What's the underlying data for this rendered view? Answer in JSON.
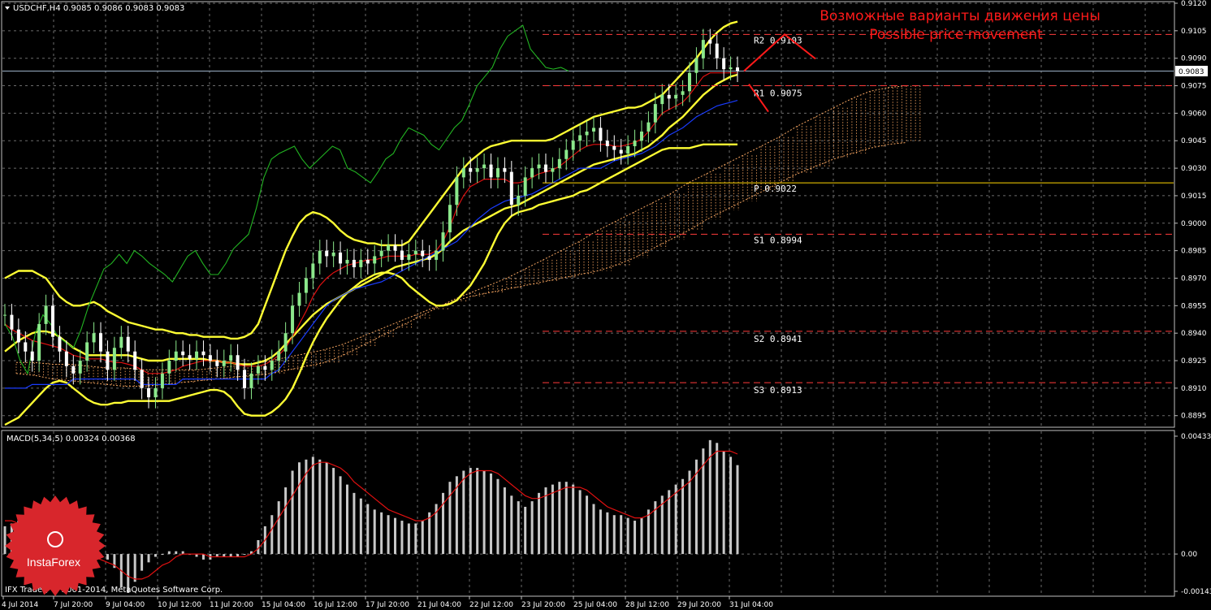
{
  "header": {
    "symbol_line": "USDCHF,H4  0.9085 0.9086 0.9083 0.9083",
    "annotation_ru": "Возможные варианты движения цены",
    "annotation_en": "Possible price movement"
  },
  "macd": {
    "label": "MACD(5,34,5) 0.00324 0.00368",
    "y_ticks": [
      "0.00433",
      "0.00",
      "-0.00143"
    ]
  },
  "footer": {
    "copyright": "IFX Trader, © 2001-2014, MetaQuotes Software Corp."
  },
  "logo": {
    "text": "InstaForex"
  },
  "chart_data": {
    "type": "candlestick",
    "symbol": "USDCHF",
    "timeframe": "H4",
    "ohlc_last": {
      "open": 0.9085,
      "high": 0.9086,
      "low": 0.9083,
      "close": 0.9083
    },
    "price_axis": {
      "ylim": [
        0.889,
        0.912
      ],
      "ticks": [
        "0.9120",
        "0.9105",
        "0.9090",
        "0.9075",
        "0.9060",
        "0.9045",
        "0.9030",
        "0.9015",
        "0.9000",
        "0.8985",
        "0.8970",
        "0.8955",
        "0.8940",
        "0.8925",
        "0.8910",
        "0.8895"
      ]
    },
    "current_price": "0.9083",
    "x_ticks": [
      "4 Jul 2014",
      "7 Jul 20:00",
      "9 Jul 04:00",
      "10 Jul 12:00",
      "11 Jul 20:00",
      "15 Jul 04:00",
      "16 Jul 12:00",
      "17 Jul 20:00",
      "21 Jul 04:00",
      "22 Jul 12:00",
      "23 Jul 20:00",
      "25 Jul 04:00",
      "28 Jul 12:00",
      "29 Jul 20:00",
      "31 Jul 04:00"
    ],
    "pivot_levels": [
      {
        "name": "R2",
        "value": 0.9103,
        "label": "R2  0.9103",
        "color": "#ff3b3b"
      },
      {
        "name": "R1",
        "value": 0.9075,
        "label": "R1  0.9075",
        "color": "#ff3b3b"
      },
      {
        "name": "P",
        "value": 0.9022,
        "label": "P  0.9022",
        "color": "#ffd700"
      },
      {
        "name": "S1",
        "value": 0.8994,
        "label": "S1  0.8994",
        "color": "#ff3b3b"
      },
      {
        "name": "S2",
        "value": 0.8941,
        "label": "S2  0.8941",
        "color": "#ff3b3b"
      },
      {
        "name": "S3",
        "value": 0.8913,
        "label": "S3  0.8913",
        "color": "#ff3b3b"
      }
    ],
    "series": {
      "close": [
        0.895,
        0.8942,
        0.8935,
        0.893,
        0.8925,
        0.8945,
        0.8955,
        0.8938,
        0.893,
        0.8922,
        0.8918,
        0.8925,
        0.8935,
        0.894,
        0.893,
        0.892,
        0.8932,
        0.8938,
        0.893,
        0.892,
        0.891,
        0.8905,
        0.891,
        0.8918,
        0.8925,
        0.893,
        0.8928,
        0.8926,
        0.893,
        0.8928,
        0.8925,
        0.8922,
        0.8925,
        0.8928,
        0.892,
        0.891,
        0.8918,
        0.8922,
        0.892,
        0.8925,
        0.893,
        0.894,
        0.8955,
        0.8962,
        0.897,
        0.8978,
        0.8985,
        0.8982,
        0.8984,
        0.8978,
        0.898,
        0.8976,
        0.898,
        0.8978,
        0.8982,
        0.8985,
        0.8988,
        0.8985,
        0.898,
        0.8983,
        0.8985,
        0.8982,
        0.898,
        0.8985,
        0.8995,
        0.901,
        0.9025,
        0.903,
        0.9028,
        0.903,
        0.9032,
        0.9025,
        0.903,
        0.9028,
        0.901,
        0.9015,
        0.9025,
        0.903,
        0.9032,
        0.9028,
        0.903,
        0.9035,
        0.904,
        0.9045,
        0.9048,
        0.905,
        0.9052,
        0.9045,
        0.9042,
        0.904,
        0.9038,
        0.9042,
        0.9045,
        0.905,
        0.9055,
        0.9065,
        0.907,
        0.9068,
        0.907,
        0.9072,
        0.9082,
        0.909,
        0.91,
        0.9098,
        0.909,
        0.9084,
        0.9085,
        0.9083
      ],
      "tenkan": [
        0.8945,
        0.8942,
        0.894,
        0.8938,
        0.8936,
        0.8935,
        0.8934,
        0.8933,
        0.8932,
        0.893,
        0.8928,
        0.8927,
        0.8926,
        0.8926,
        0.8926,
        0.8925,
        0.8924,
        0.8924,
        0.8923,
        0.8922,
        0.892,
        0.8918,
        0.8918,
        0.8918,
        0.8919,
        0.892,
        0.8922,
        0.8923,
        0.8924,
        0.8925,
        0.8925,
        0.8925,
        0.8924,
        0.8924,
        0.8923,
        0.8922,
        0.8922,
        0.8922,
        0.8923,
        0.8925,
        0.8928,
        0.8932,
        0.8938,
        0.8945,
        0.8952,
        0.896,
        0.8966,
        0.897,
        0.8973,
        0.8975,
        0.8977,
        0.8978,
        0.8979,
        0.898,
        0.898,
        0.8981,
        0.8982,
        0.8982,
        0.8982,
        0.8982,
        0.8983,
        0.8983,
        0.8983,
        0.8985,
        0.899,
        0.8998,
        0.9008,
        0.9015,
        0.902,
        0.9022,
        0.9024,
        0.9024,
        0.9024,
        0.9024,
        0.9022,
        0.9022,
        0.9023,
        0.9025,
        0.9027,
        0.9028,
        0.9029,
        0.9031,
        0.9034,
        0.9037,
        0.904,
        0.9042,
        0.9043,
        0.9043,
        0.9043,
        0.9042,
        0.9042,
        0.9043,
        0.9044,
        0.9046,
        0.905,
        0.9055,
        0.906,
        0.9062,
        0.9064,
        0.9066,
        0.907,
        0.9075,
        0.908,
        0.9082,
        0.9082,
        0.9082,
        0.9082,
        0.9082
      ],
      "kijun": [
        0.891,
        0.891,
        0.891,
        0.891,
        0.8912,
        0.8912,
        0.8912,
        0.8912,
        0.8912,
        0.8912,
        0.8915,
        0.8915,
        0.8915,
        0.8915,
        0.8915,
        0.8915,
        0.8915,
        0.8915,
        0.8915,
        0.8915,
        0.8912,
        0.8912,
        0.8912,
        0.8912,
        0.8912,
        0.8912,
        0.8915,
        0.8915,
        0.8915,
        0.8915,
        0.8915,
        0.8915,
        0.8915,
        0.8915,
        0.8915,
        0.8915,
        0.8915,
        0.8915,
        0.8915,
        0.8918,
        0.892,
        0.8925,
        0.893,
        0.8935,
        0.894,
        0.8945,
        0.895,
        0.8955,
        0.8958,
        0.896,
        0.8962,
        0.8964,
        0.8965,
        0.8966,
        0.8967,
        0.8968,
        0.897,
        0.8972,
        0.8974,
        0.8976,
        0.8978,
        0.898,
        0.8982,
        0.8984,
        0.8986,
        0.8988,
        0.899,
        0.8994,
        0.8998,
        0.9002,
        0.9005,
        0.9008,
        0.901,
        0.9012,
        0.9013,
        0.9014,
        0.9015,
        0.9016,
        0.9018,
        0.902,
        0.9022,
        0.9024,
        0.9026,
        0.9028,
        0.903,
        0.903,
        0.903,
        0.903,
        0.9032,
        0.9034,
        0.9035,
        0.9036,
        0.9037,
        0.9038,
        0.904,
        0.9042,
        0.9045,
        0.9048,
        0.905,
        0.9052,
        0.9055,
        0.9058,
        0.906,
        0.9062,
        0.9064,
        0.9065,
        0.9066,
        0.9067
      ],
      "bb_mid": [
        0.893,
        0.8933,
        0.8936,
        0.8938,
        0.894,
        0.8941,
        0.8941,
        0.894,
        0.8938,
        0.8935,
        0.8932,
        0.893,
        0.8928,
        0.8928,
        0.8928,
        0.8928,
        0.8928,
        0.8928,
        0.8928,
        0.8927,
        0.8926,
        0.8925,
        0.8925,
        0.8925,
        0.8926,
        0.8926,
        0.8926,
        0.8926,
        0.8926,
        0.8926,
        0.8925,
        0.8925,
        0.8924,
        0.8924,
        0.8923,
        0.8923,
        0.8923,
        0.8924,
        0.8925,
        0.8927,
        0.893,
        0.8934,
        0.8938,
        0.8942,
        0.8946,
        0.895,
        0.8953,
        0.8956,
        0.8958,
        0.896,
        0.8962,
        0.8964,
        0.8966,
        0.8968,
        0.897,
        0.8972,
        0.8974,
        0.8976,
        0.8977,
        0.8978,
        0.8979,
        0.898,
        0.8981,
        0.8983,
        0.8986,
        0.899,
        0.8993,
        0.8996,
        0.8998,
        0.9,
        0.9002,
        0.9004,
        0.9006,
        0.9008,
        0.9009,
        0.901,
        0.9012,
        0.9014,
        0.9016,
        0.9018,
        0.902,
        0.9022,
        0.9024,
        0.9026,
        0.9028,
        0.903,
        0.9032,
        0.9033,
        0.9034,
        0.9035,
        0.9036,
        0.9037,
        0.9038,
        0.904,
        0.9042,
        0.9045,
        0.9048,
        0.9052,
        0.9055,
        0.9058,
        0.9062,
        0.9066,
        0.907,
        0.9073,
        0.9076,
        0.9078,
        0.908,
        0.9081
      ],
      "bb_up": [
        0.897,
        0.8972,
        0.8974,
        0.8974,
        0.8974,
        0.8972,
        0.897,
        0.8965,
        0.896,
        0.8957,
        0.8955,
        0.8955,
        0.8956,
        0.8957,
        0.8955,
        0.8952,
        0.895,
        0.8948,
        0.8946,
        0.8945,
        0.8944,
        0.8943,
        0.8942,
        0.8942,
        0.8941,
        0.894,
        0.894,
        0.8939,
        0.8939,
        0.8938,
        0.8938,
        0.8938,
        0.8938,
        0.8937,
        0.8937,
        0.8938,
        0.894,
        0.8945,
        0.8955,
        0.8965,
        0.8975,
        0.8985,
        0.8993,
        0.9,
        0.9004,
        0.9006,
        0.9005,
        0.9003,
        0.9,
        0.8996,
        0.8993,
        0.8991,
        0.899,
        0.8989,
        0.8989,
        0.8988,
        0.8988,
        0.8988,
        0.8988,
        0.899,
        0.8995,
        0.9,
        0.9005,
        0.901,
        0.9015,
        0.902,
        0.9025,
        0.903,
        0.9034,
        0.9037,
        0.904,
        0.9042,
        0.9043,
        0.9044,
        0.9045,
        0.9045,
        0.9045,
        0.9045,
        0.9045,
        0.9045,
        0.9046,
        0.9048,
        0.905,
        0.9052,
        0.9054,
        0.9056,
        0.9058,
        0.9059,
        0.906,
        0.9061,
        0.9062,
        0.9063,
        0.9063,
        0.9064,
        0.9066,
        0.9068,
        0.907,
        0.9074,
        0.9078,
        0.9082,
        0.9086,
        0.909,
        0.9095,
        0.91,
        0.9104,
        0.9107,
        0.9109,
        0.911
      ],
      "bb_low": [
        0.889,
        0.8892,
        0.8894,
        0.8898,
        0.8902,
        0.8906,
        0.891,
        0.8913,
        0.8914,
        0.8913,
        0.891,
        0.8907,
        0.8904,
        0.8902,
        0.8901,
        0.8901,
        0.8902,
        0.8902,
        0.8903,
        0.8903,
        0.8903,
        0.8903,
        0.8903,
        0.8903,
        0.8903,
        0.8904,
        0.8905,
        0.8906,
        0.8907,
        0.8908,
        0.8909,
        0.8909,
        0.8908,
        0.8905,
        0.89,
        0.8896,
        0.8895,
        0.8895,
        0.8895,
        0.8897,
        0.89,
        0.8904,
        0.891,
        0.8918,
        0.8927,
        0.8935,
        0.8942,
        0.8948,
        0.8953,
        0.8958,
        0.8962,
        0.8965,
        0.8968,
        0.897,
        0.8972,
        0.8973,
        0.8973,
        0.8972,
        0.897,
        0.8966,
        0.8963,
        0.896,
        0.8957,
        0.8955,
        0.8955,
        0.8956,
        0.8958,
        0.8962,
        0.8966,
        0.8972,
        0.8978,
        0.8986,
        0.8994,
        0.9,
        0.9004,
        0.9006,
        0.9007,
        0.9008,
        0.901,
        0.9011,
        0.9012,
        0.9013,
        0.9014,
        0.9015,
        0.9017,
        0.9018,
        0.902,
        0.9022,
        0.9024,
        0.9026,
        0.9028,
        0.903,
        0.9032,
        0.9034,
        0.9036,
        0.9038,
        0.904,
        0.9041,
        0.9041,
        0.9041,
        0.9041,
        0.9042,
        0.9043,
        0.9043,
        0.9043,
        0.9043,
        0.9043,
        0.9043
      ],
      "chikou": [
        0.8945,
        0.8938,
        0.8925,
        0.8918,
        0.894,
        0.895,
        0.8945,
        0.8938,
        0.8935,
        0.8932,
        0.8942,
        0.8955,
        0.8965,
        0.8975,
        0.8978,
        0.8983,
        0.8978,
        0.8985,
        0.8982,
        0.8978,
        0.8975,
        0.8972,
        0.8968,
        0.8975,
        0.8982,
        0.8985,
        0.8978,
        0.8972,
        0.8972,
        0.8978,
        0.8986,
        0.899,
        0.8994,
        0.9008,
        0.9025,
        0.9035,
        0.9038,
        0.904,
        0.9042,
        0.9035,
        0.903,
        0.9034,
        0.9038,
        0.9042,
        0.904,
        0.903,
        0.9028,
        0.9025,
        0.9022,
        0.9028,
        0.9035,
        0.9038,
        0.9046,
        0.9052,
        0.905,
        0.9048,
        0.9043,
        0.904,
        0.9046,
        0.9052,
        0.9056,
        0.9065,
        0.9075,
        0.908,
        0.9085,
        0.9095,
        0.9102,
        0.9105,
        0.9108,
        0.9095,
        0.909,
        0.9085,
        0.9084,
        0.9085,
        0.9083
      ]
    },
    "cloud_top": [
      0.8918,
      0.8917,
      0.8915,
      0.8914,
      0.8913,
      0.8912,
      0.8911,
      0.8911,
      0.8912,
      0.8913,
      0.8914,
      0.8915,
      0.8916,
      0.8917,
      0.8918,
      0.892,
      0.8922,
      0.8924,
      0.8928,
      0.8933,
      0.8938,
      0.8943,
      0.8948,
      0.8953,
      0.8958,
      0.8962,
      0.8966,
      0.897,
      0.8975,
      0.898,
      0.8985,
      0.899,
      0.8996,
      0.9001,
      0.9006,
      0.9011,
      0.9016,
      0.9022,
      0.9027,
      0.9032,
      0.9037,
      0.9042,
      0.9047,
      0.9053,
      0.9058,
      0.9063,
      0.9068,
      0.9072,
      0.9074,
      0.9075
    ],
    "cloud_bottom": [
      0.8924,
      0.8924,
      0.8923,
      0.8923,
      0.8922,
      0.8921,
      0.8921,
      0.892,
      0.892,
      0.892,
      0.892,
      0.8921,
      0.8922,
      0.8923,
      0.8925,
      0.8927,
      0.8929,
      0.8931,
      0.8934,
      0.8938,
      0.8942,
      0.8946,
      0.895,
      0.8954,
      0.8957,
      0.896,
      0.8962,
      0.8964,
      0.8966,
      0.8968,
      0.897,
      0.8972,
      0.8974,
      0.8977,
      0.8981,
      0.8986,
      0.8991,
      0.8996,
      0.9002,
      0.9007,
      0.9012,
      0.9017,
      0.9022,
      0.9027,
      0.9031,
      0.9035,
      0.9038,
      0.9041,
      0.9043,
      0.9044
    ],
    "macd_hist": [
      0.001,
      0.0011,
      0.0012,
      0.0012,
      0.0011,
      0.001,
      0.0009,
      0.0007,
      0.0005,
      0.0004,
      0.0003,
      0.0002,
      0.0001,
      0.0,
      -0.0001,
      -0.0002,
      -0.0005,
      -0.0012,
      -0.0014,
      -0.001,
      -0.0006,
      -0.0003,
      -0.0001,
      0.0,
      0.0001,
      0.0001,
      0.0001,
      0.0,
      -0.0001,
      -0.0002,
      -0.0002,
      -0.0001,
      -0.0001,
      -0.0001,
      -0.0001,
      0.0,
      0.0001,
      0.0005,
      0.001,
      0.0014,
      0.0019,
      0.0024,
      0.003,
      0.0033,
      0.0034,
      0.0035,
      0.0034,
      0.0033,
      0.0031,
      0.0028,
      0.0025,
      0.0022,
      0.002,
      0.0018,
      0.0016,
      0.0015,
      0.0014,
      0.0013,
      0.0012,
      0.0011,
      0.0011,
      0.0012,
      0.0015,
      0.0018,
      0.0022,
      0.0026,
      0.0028,
      0.003,
      0.0031,
      0.0031,
      0.003,
      0.0029,
      0.0027,
      0.0024,
      0.0021,
      0.0019,
      0.0017,
      0.0019,
      0.0022,
      0.0024,
      0.0025,
      0.0026,
      0.0026,
      0.0025,
      0.0023,
      0.0021,
      0.0018,
      0.0016,
      0.0015,
      0.0014,
      0.0014,
      0.0013,
      0.0012,
      0.0013,
      0.0016,
      0.0019,
      0.0021,
      0.0023,
      0.0025,
      0.0027,
      0.003,
      0.0034,
      0.0038,
      0.0041,
      0.004,
      0.0037,
      0.0035,
      0.0032
    ],
    "macd_signal": [
      0.0012,
      0.0012,
      0.0011,
      0.0011,
      0.001,
      0.0009,
      0.0008,
      0.0007,
      0.0005,
      0.0004,
      0.0003,
      0.0001,
      0.0,
      -0.0001,
      -0.0002,
      -0.0003,
      -0.0004,
      -0.0006,
      -0.0008,
      -0.0009,
      -0.0009,
      -0.0008,
      -0.0006,
      -0.0004,
      -0.0003,
      -0.0001,
      0.0,
      0.0,
      0.0,
      0.0,
      -0.0001,
      -0.0001,
      -0.0001,
      -0.0001,
      -0.0001,
      -0.0001,
      0.0,
      0.0002,
      0.0005,
      0.0009,
      0.0013,
      0.0017,
      0.0021,
      0.0025,
      0.0029,
      0.0032,
      0.0033,
      0.0033,
      0.0032,
      0.0031,
      0.0029,
      0.0026,
      0.0024,
      0.0022,
      0.002,
      0.0018,
      0.0016,
      0.0015,
      0.0014,
      0.0013,
      0.0012,
      0.0012,
      0.0013,
      0.0015,
      0.0018,
      0.0021,
      0.0024,
      0.0027,
      0.0029,
      0.003,
      0.003,
      0.003,
      0.0029,
      0.0027,
      0.0025,
      0.0023,
      0.0021,
      0.002,
      0.002,
      0.0021,
      0.0022,
      0.0023,
      0.0024,
      0.0024,
      0.0024,
      0.0023,
      0.0021,
      0.0019,
      0.0017,
      0.0016,
      0.0015,
      0.0014,
      0.0013,
      0.0013,
      0.0014,
      0.0016,
      0.0018,
      0.002,
      0.0022,
      0.0024,
      0.0026,
      0.0029,
      0.0032,
      0.0035,
      0.0037,
      0.0037,
      0.0037,
      0.0036
    ]
  },
  "colors": {
    "background": "#000000",
    "grid": "#6b6b6b",
    "candle_up": "#8be88b",
    "candle_down": "#ffffff",
    "tenkan": "#e01010",
    "kijun": "#1a3cff",
    "bollinger": "#ffff33",
    "chikou": "#22b422",
    "cloud": "#f4a460",
    "pivot_main": "#ffd700",
    "macd_hist": "#c8c8c8",
    "macd_signal": "#e01010",
    "annotation": "#ff1a1a",
    "current_price_line": "#9ab0c6"
  }
}
